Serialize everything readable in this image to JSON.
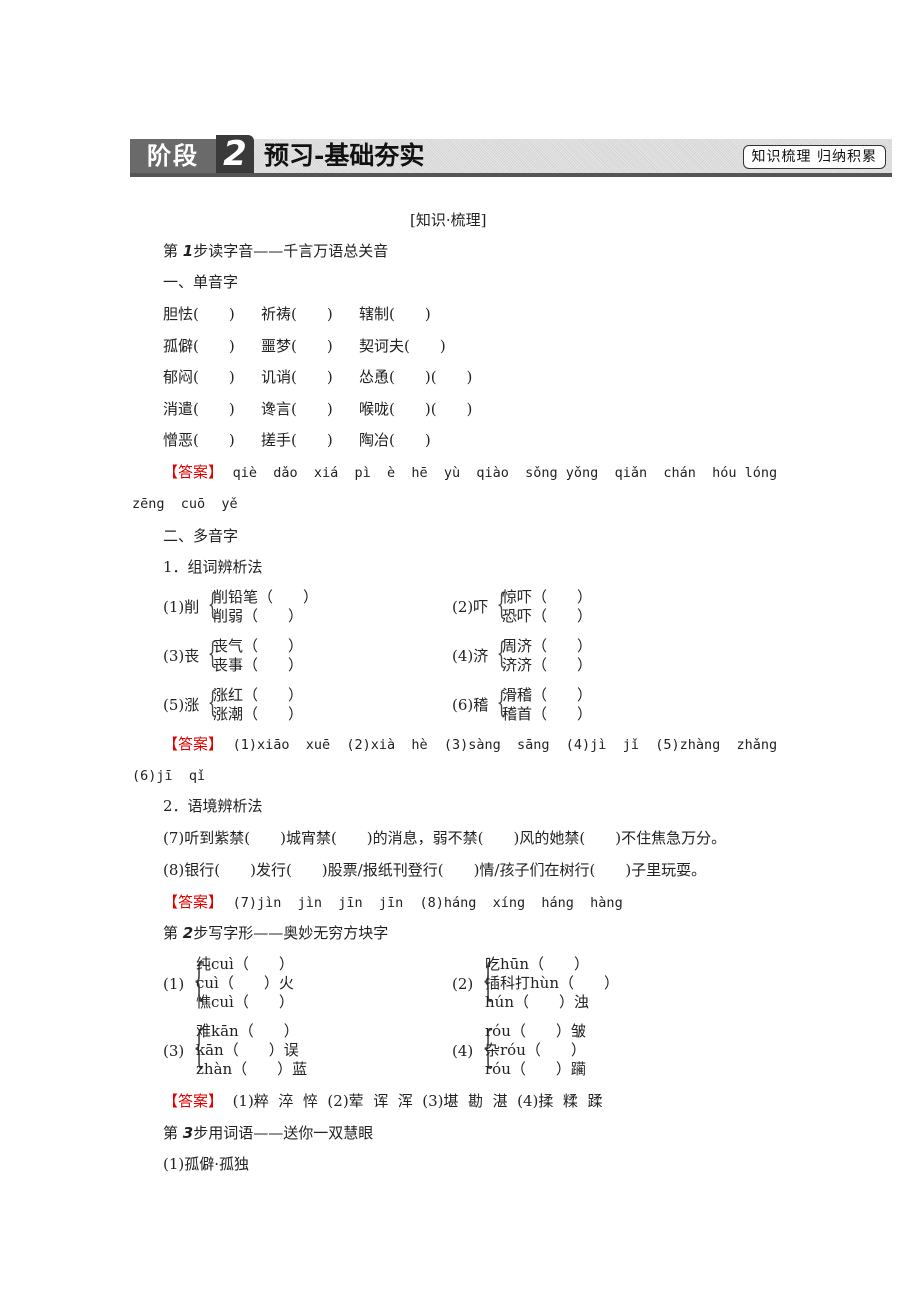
{
  "banner": {
    "stage_label": "阶段",
    "stage_number": "2",
    "title": "预习-基础夯实",
    "tag": "知识梳理 归纳积累"
  },
  "section_heading": "[知识·梳理]",
  "step1": {
    "prefix": "第",
    "number": "1",
    "title": "步读字音——千言万语总关音",
    "part1": {
      "heading": "一、单音字",
      "rows": [
        [
          "胆怯(　　)",
          "祈祷(　　)",
          "辖制(　　)"
        ],
        [
          "孤僻(　　)",
          "噩梦(　　)",
          "契诃夫(　　)"
        ],
        [
          "郁闷(　　)",
          "讥诮(　　)",
          "怂恿(　　)(　　)"
        ],
        [
          "消遣(　　)",
          "谗言(　　)",
          "喉咙(　　)(　　)"
        ],
        [
          "憎恶(　　)",
          "搓手(　　)",
          "陶冶(　　)"
        ]
      ],
      "answer_label": "【答案】",
      "answer_line1": "qiè  dǎo  xiá  pì  è  hē  yù  qiào  sǒng yǒng  qiǎn  chán  hóu lóng",
      "answer_line2": "zēng  cuō  yě"
    },
    "part2": {
      "heading": "二、多音字",
      "method1": {
        "title": "1．组词辨析法",
        "groups": [
          {
            "label": "(1)削",
            "items": [
              "削铅笔（　　）",
              "削弱（　　）"
            ]
          },
          {
            "label": "(2)吓",
            "items": [
              "惊吓（　　）",
              "恐吓（　　）"
            ]
          },
          {
            "label": "(3)丧",
            "items": [
              "丧气（　　）",
              "丧事（　　）"
            ]
          },
          {
            "label": "(4)济",
            "items": [
              "周济（　　）",
              "济济（　　）"
            ]
          },
          {
            "label": "(5)涨",
            "items": [
              "涨红（　　）",
              "涨潮（　　）"
            ]
          },
          {
            "label": "(6)稽",
            "items": [
              "滑稽（　　）",
              "稽首（　　）"
            ]
          }
        ],
        "answer_label": "【答案】",
        "answer_line1": "(1)xiāo  xuē  (2)xià  hè  (3)sàng  sāng  (4)jì  jǐ  (5)zhàng  zhǎng",
        "answer_line2": "(6)jī  qǐ"
      },
      "method2": {
        "title": "2．语境辨析法",
        "sentence7": "(7)听到紫禁(　　)城宵禁(　　)的消息，弱不禁(　　)风的她禁(　　)不住焦急万分。",
        "sentence8": "(8)银行(　　)发行(　　)股票/报纸刊登行(　　)情/孩子们在树行(　　)子里玩耍。",
        "answer_label": "【答案】",
        "answer": "(7)jìn  jìn  jīn  jīn  (8)háng  xíng  háng  hàng"
      }
    }
  },
  "step2": {
    "prefix": "第",
    "number": "2",
    "title": "步写字形——奥妙无穷方块字",
    "groups": [
      {
        "label": "(1)",
        "items": [
          "纯cuì（　　）",
          "cuì（　　）火",
          "憔cuì（　　）"
        ]
      },
      {
        "label": "(2)",
        "items": [
          "吃hūn（　　）",
          "插科打hùn（　　）",
          "hún（　　）浊"
        ]
      },
      {
        "label": "(3)",
        "items": [
          "难kān（　　）",
          "kān（　　）误",
          "zhàn（　　）蓝"
        ]
      },
      {
        "label": "(4)",
        "items": [
          "róu（　　）皱",
          "杂róu（　　）",
          "róu（　　）躏"
        ]
      }
    ],
    "answer_label": "【答案】",
    "answer": "(1)粹  淬  悴  (2)荤  诨  浑  (3)堪  勘  湛  (4)揉  糅  蹂"
  },
  "step3": {
    "prefix": "第",
    "number": "3",
    "title": "步用词语——送你一双慧眼",
    "item1": "(1)孤僻·孤独"
  }
}
